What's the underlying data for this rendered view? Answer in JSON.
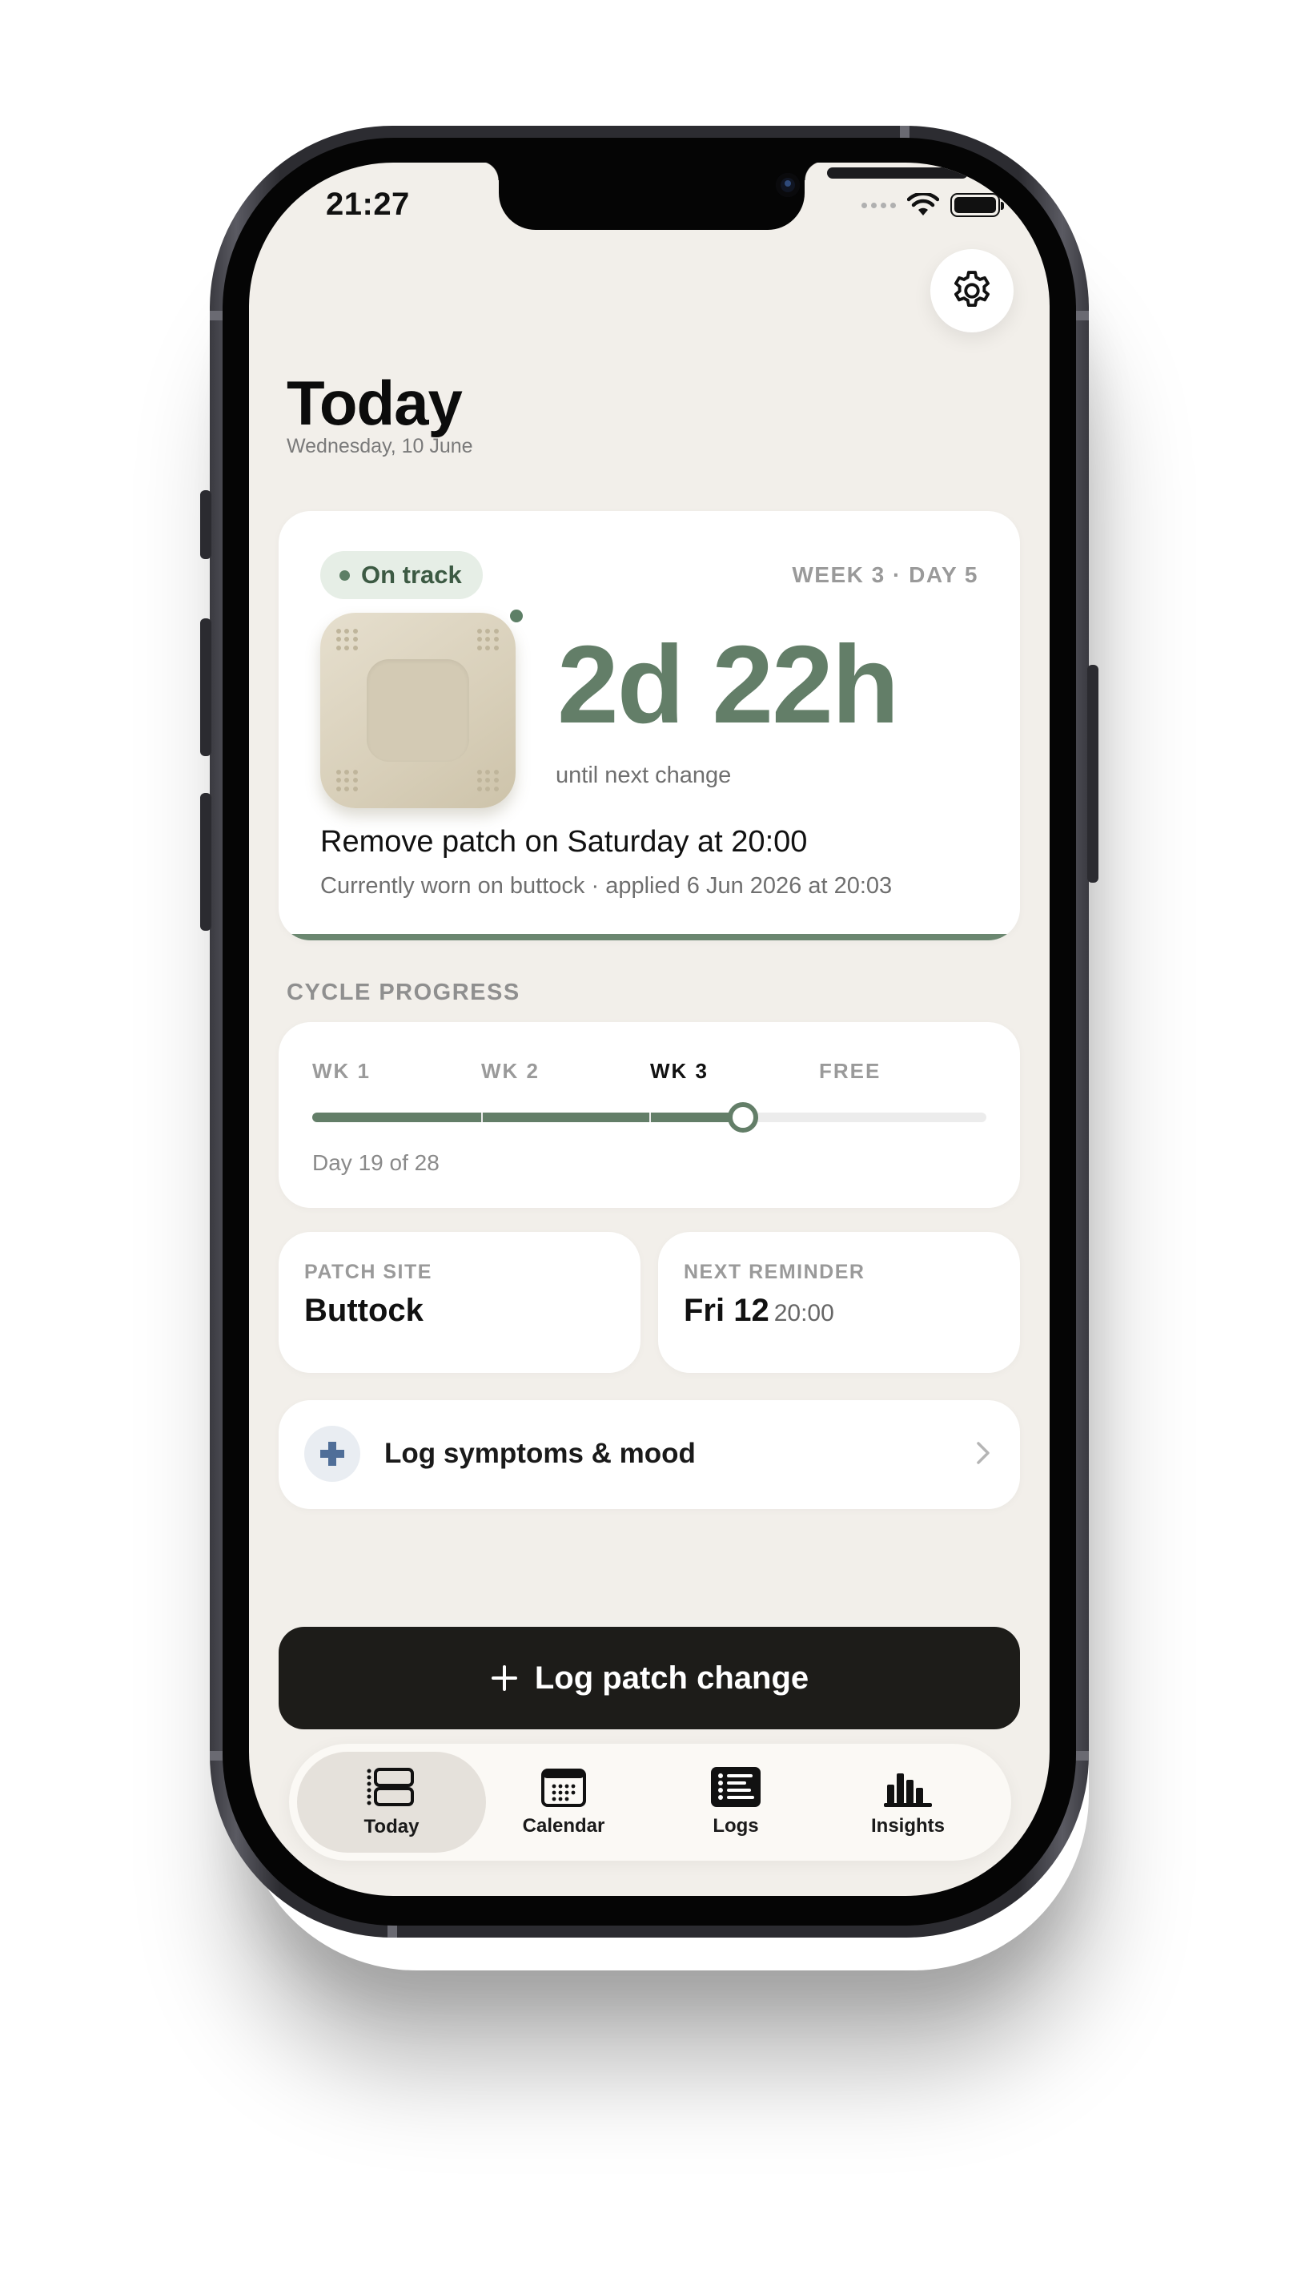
{
  "status_bar": {
    "time": "21:27"
  },
  "header": {
    "title": "Today",
    "date": "Wednesday, 10 June"
  },
  "hero": {
    "status_badge": "On track",
    "week_day": "WEEK 3 · DAY 5",
    "countdown": "2d 22h",
    "countdown_caption": "until next change",
    "remove_text": "Remove patch on Saturday at 20:00",
    "worn_text": "Currently worn on buttock · applied 6 Jun 2026 at 20:03"
  },
  "cycle": {
    "section_label": "CYCLE PROGRESS",
    "weeks": [
      "WK 1",
      "WK 2",
      "WK 3",
      "FREE"
    ],
    "active_week_index": 2,
    "day_label": "Day 19 of 28",
    "day": 19,
    "total_days": 28
  },
  "patch_site": {
    "label": "PATCH SITE",
    "value": "Buttock"
  },
  "next_reminder": {
    "label": "NEXT REMINDER",
    "day": "Fri 12",
    "time": "20:00"
  },
  "log_symptoms": {
    "label": "Log symptoms & mood"
  },
  "primary_action": {
    "label": "Log patch change"
  },
  "tabs": [
    {
      "label": "Today",
      "icon": "today-cards-icon"
    },
    {
      "label": "Calendar",
      "icon": "calendar-icon"
    },
    {
      "label": "Logs",
      "icon": "list-icon"
    },
    {
      "label": "Insights",
      "icon": "bar-chart-icon"
    }
  ],
  "colors": {
    "accent": "#637e68",
    "background": "#f2efea",
    "primary_button": "#1d1c19",
    "badge_bg": "#e6eee6"
  }
}
